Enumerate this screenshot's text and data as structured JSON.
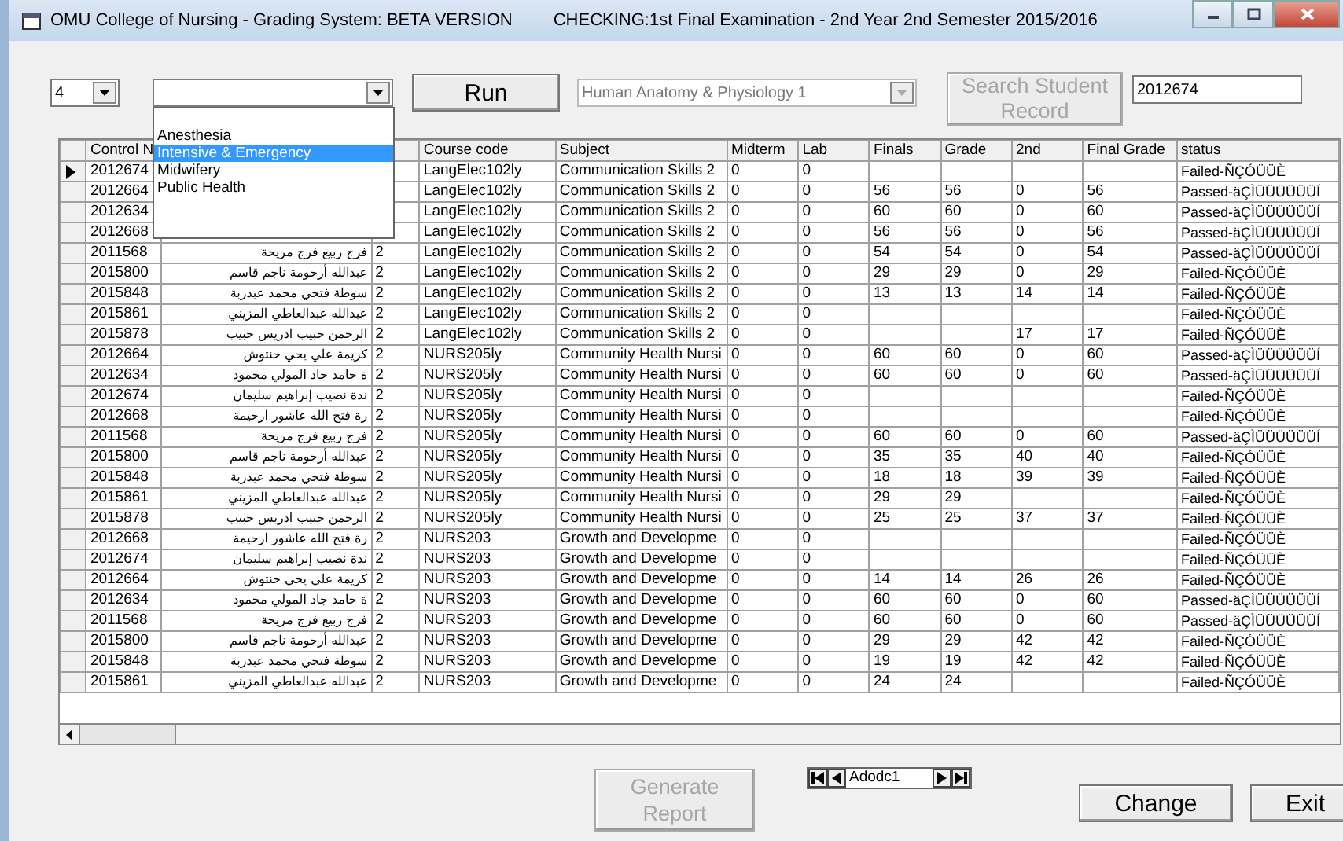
{
  "window": {
    "title": "OMU College of Nursing - Grading System: BETA VERSION",
    "checking": "CHECKING:1st Final Examination - 2nd Year 2nd Semester 2015/2016"
  },
  "year_combo": {
    "value": "4"
  },
  "department_combo": {
    "open": true,
    "options": [
      {
        "label": "Anesthesia",
        "selected": false
      },
      {
        "label": "Intensive & Emergency",
        "selected": true
      },
      {
        "label": "Midwifery",
        "selected": false
      },
      {
        "label": "Public Health",
        "selected": false
      }
    ]
  },
  "run_button": "Run",
  "subject_combo": {
    "value": "Human Anatomy & Physiology 1",
    "disabled": true
  },
  "search_button": {
    "label": "Search Student Record",
    "disabled": true
  },
  "search_field": {
    "value": "2012674"
  },
  "table": {
    "headings": {
      "control_no": "Control N",
      "course_code": "Course code",
      "subject": "Subject",
      "midterm": "Midterm",
      "lab": "Lab",
      "finals": "Finals",
      "grade": "Grade",
      "second": "2nd",
      "final_grade": "Final Grade",
      "status": "status"
    },
    "rows": [
      {
        "selected": true,
        "control_no": "2012674",
        "course_code": "LangElec102ly",
        "subject": "Communication Skills 2",
        "midterm": "0",
        "lab": "0",
        "status": "Failed-ÑÇÓÜÜÈ"
      },
      {
        "selected": false,
        "control_no": "2012664",
        "course_code": "LangElec102ly",
        "subject": "Communication Skills 2",
        "midterm": "0",
        "lab": "0",
        "finals": "56",
        "grade": "56",
        "second": "0",
        "final_grade": "56",
        "status": "Passed-äÇÌÜÜÜÜÜÜÍ"
      },
      {
        "selected": false,
        "control_no": "2012634",
        "course_code": "LangElec102ly",
        "subject": "Communication Skills 2",
        "midterm": "0",
        "lab": "0",
        "finals": "60",
        "grade": "60",
        "second": "0",
        "final_grade": "60",
        "status": "Passed-äÇÌÜÜÜÜÜÜÍ"
      },
      {
        "selected": false,
        "control_no": "2012668",
        "course_code": "LangElec102ly",
        "subject": "Communication Skills 2",
        "midterm": "0",
        "lab": "0",
        "finals": "56",
        "grade": "56",
        "second": "0",
        "final_grade": "56",
        "status": "Passed-äÇÌÜÜÜÜÜÜÍ"
      },
      {
        "selected": false,
        "control_no": "2011568",
        "name": "فرج ربيع فرج مريحة",
        "column_3": "2",
        "course_code": "LangElec102ly",
        "subject": "Communication Skills 2",
        "midterm": "0",
        "lab": "0",
        "finals": "54",
        "grade": "54",
        "second": "0",
        "final_grade": "54",
        "status": "Passed-äÇÌÜÜÜÜÜÜÍ"
      },
      {
        "selected": false,
        "control_no": "2015800",
        "name": "عبدالله أرحومة ناجم قاسم",
        "column_3": "2",
        "course_code": "LangElec102ly",
        "subject": "Communication Skills 2",
        "midterm": "0",
        "lab": "0",
        "finals": "29",
        "grade": "29",
        "second": "0",
        "final_grade": "29",
        "status": "Failed-ÑÇÓÜÜÈ"
      },
      {
        "selected": false,
        "control_no": "2015848",
        "name": "سوطة فتحي محمد عبدربة",
        "column_3": "2",
        "course_code": "LangElec102ly",
        "subject": "Communication Skills 2",
        "midterm": "0",
        "lab": "0",
        "finals": "13",
        "grade": "13",
        "second": "14",
        "final_grade": "14",
        "status": "Failed-ÑÇÓÜÜÈ"
      },
      {
        "selected": false,
        "control_no": "2015861",
        "name": "عبدالله عبدالعاطي المزيني",
        "column_3": "2",
        "course_code": "LangElec102ly",
        "subject": "Communication Skills 2",
        "midterm": "0",
        "lab": "0",
        "status": "Failed-ÑÇÓÜÜÈ"
      },
      {
        "selected": false,
        "control_no": "2015878",
        "name": "الرحمن حبيب ادريس حبيب",
        "column_3": "2",
        "course_code": "LangElec102ly",
        "subject": "Communication Skills 2",
        "midterm": "0",
        "lab": "0",
        "second": "17",
        "final_grade": "17",
        "status": "Failed-ÑÇÓÜÜÈ"
      },
      {
        "selected": false,
        "control_no": "2012664",
        "name": "كريمة علي يحي حنتوش",
        "column_3": "2",
        "course_code": "NURS205ly",
        "subject": "Community Health Nursi",
        "midterm": "0",
        "lab": "0",
        "finals": "60",
        "grade": "60",
        "second": "0",
        "final_grade": "60",
        "status": "Passed-äÇÌÜÜÜÜÜÜÍ"
      },
      {
        "selected": false,
        "control_no": "2012634",
        "name": "ة حامد جاد المولي محمود",
        "column_3": "2",
        "course_code": "NURS205ly",
        "subject": "Community Health Nursi",
        "midterm": "0",
        "lab": "0",
        "finals": "60",
        "grade": "60",
        "second": "0",
        "final_grade": "60",
        "status": "Passed-äÇÌÜÜÜÜÜÜÍ"
      },
      {
        "selected": false,
        "control_no": "2012674",
        "name": "ندة نصيب إبراهيم سليمان",
        "column_3": "2",
        "course_code": "NURS205ly",
        "subject": "Community Health Nursi",
        "midterm": "0",
        "lab": "0",
        "status": "Failed-ÑÇÓÜÜÈ"
      },
      {
        "selected": false,
        "control_no": "2012668",
        "name": "رة فتح الله عاشور ارحيمة",
        "column_3": "2",
        "course_code": "NURS205ly",
        "subject": "Community Health Nursi",
        "midterm": "0",
        "lab": "0",
        "status": "Failed-ÑÇÓÜÜÈ"
      },
      {
        "selected": false,
        "control_no": "2011568",
        "name": "فرج ربيع فرج مريحة",
        "column_3": "2",
        "course_code": "NURS205ly",
        "subject": "Community Health Nursi",
        "midterm": "0",
        "lab": "0",
        "finals": "60",
        "grade": "60",
        "second": "0",
        "final_grade": "60",
        "status": "Passed-äÇÌÜÜÜÜÜÜÍ"
      },
      {
        "selected": false,
        "control_no": "2015800",
        "name": "عبدالله أرحومة ناجم قاسم",
        "column_3": "2",
        "course_code": "NURS205ly",
        "subject": "Community Health Nursi",
        "midterm": "0",
        "lab": "0",
        "finals": "35",
        "grade": "35",
        "second": "40",
        "final_grade": "40",
        "status": "Failed-ÑÇÓÜÜÈ"
      },
      {
        "selected": false,
        "control_no": "2015848",
        "name": "سوطة فتحي محمد عبدربة",
        "column_3": "2",
        "course_code": "NURS205ly",
        "subject": "Community Health Nursi",
        "midterm": "0",
        "lab": "0",
        "finals": "18",
        "grade": "18",
        "second": "39",
        "final_grade": "39",
        "status": "Failed-ÑÇÓÜÜÈ"
      },
      {
        "selected": false,
        "control_no": "2015861",
        "name": "عبدالله عبدالعاطي المزيني",
        "column_3": "2",
        "course_code": "NURS205ly",
        "subject": "Community Health Nursi",
        "midterm": "0",
        "lab": "0",
        "finals": "29",
        "grade": "29",
        "status": "Failed-ÑÇÓÜÜÈ"
      },
      {
        "selected": false,
        "control_no": "2015878",
        "name": "الرحمن حبيب ادريس حبيب",
        "column_3": "2",
        "course_code": "NURS205ly",
        "subject": "Community Health Nursi",
        "midterm": "0",
        "lab": "0",
        "finals": "25",
        "grade": "25",
        "second": "37",
        "final_grade": "37",
        "status": "Failed-ÑÇÓÜÜÈ"
      },
      {
        "selected": false,
        "control_no": "2012668",
        "name": "رة فتح الله عاشور ارحيمة",
        "column_3": "2",
        "course_code": "NURS203",
        "subject": "Growth and Developme",
        "midterm": "0",
        "lab": "0",
        "status": "Failed-ÑÇÓÜÜÈ"
      },
      {
        "selected": false,
        "control_no": "2012674",
        "name": "ندة نصيب إبراهيم سليمان",
        "column_3": "2",
        "course_code": "NURS203",
        "subject": "Growth and Developme",
        "midterm": "0",
        "lab": "0",
        "status": "Failed-ÑÇÓÜÜÈ"
      },
      {
        "selected": false,
        "control_no": "2012664",
        "name": "كريمة علي يحي حنتوش",
        "column_3": "2",
        "course_code": "NURS203",
        "subject": "Growth and Developme",
        "midterm": "0",
        "lab": "0",
        "finals": "14",
        "grade": "14",
        "second": "26",
        "final_grade": "26",
        "status": "Failed-ÑÇÓÜÜÈ"
      },
      {
        "selected": false,
        "control_no": "2012634",
        "name": "ة حامد جاد المولي محمود",
        "column_3": "2",
        "course_code": "NURS203",
        "subject": "Growth and Developme",
        "midterm": "0",
        "lab": "0",
        "finals": "60",
        "grade": "60",
        "second": "0",
        "final_grade": "60",
        "status": "Passed-äÇÌÜÜÜÜÜÜÍ"
      },
      {
        "selected": false,
        "control_no": "2011568",
        "name": "فرج ربيع فرج مريحة",
        "column_3": "2",
        "course_code": "NURS203",
        "subject": "Growth and Developme",
        "midterm": "0",
        "lab": "0",
        "finals": "60",
        "grade": "60",
        "second": "0",
        "final_grade": "60",
        "status": "Passed-äÇÌÜÜÜÜÜÜÍ"
      },
      {
        "selected": false,
        "control_no": "2015800",
        "name": "عبدالله أرحومة ناجم قاسم",
        "column_3": "2",
        "course_code": "NURS203",
        "subject": "Growth and Developme",
        "midterm": "0",
        "lab": "0",
        "finals": "29",
        "grade": "29",
        "second": "42",
        "final_grade": "42",
        "status": "Failed-ÑÇÓÜÜÈ"
      },
      {
        "selected": false,
        "control_no": "2015848",
        "name": "سوطة فتحي محمد عبدربة",
        "column_3": "2",
        "course_code": "NURS203",
        "subject": "Growth and Developme",
        "midterm": "0",
        "lab": "0",
        "finals": "19",
        "grade": "19",
        "second": "42",
        "final_grade": "42",
        "status": "Failed-ÑÇÓÜÜÈ"
      },
      {
        "selected": false,
        "control_no": "2015861",
        "name": "عبدالله عبدالعاطي المزيني",
        "column_3": "2",
        "course_code": "NURS203",
        "subject": "Growth and Developme",
        "midterm": "0",
        "lab": "0",
        "finals": "24",
        "grade": "24",
        "status": "Failed-ÑÇÓÜÜÈ"
      }
    ]
  },
  "generate_button": {
    "label": "Generate Report",
    "disabled": true
  },
  "data_control": {
    "caption": "Adodc1"
  },
  "change_button": "Change",
  "exit_button": "Exit"
}
